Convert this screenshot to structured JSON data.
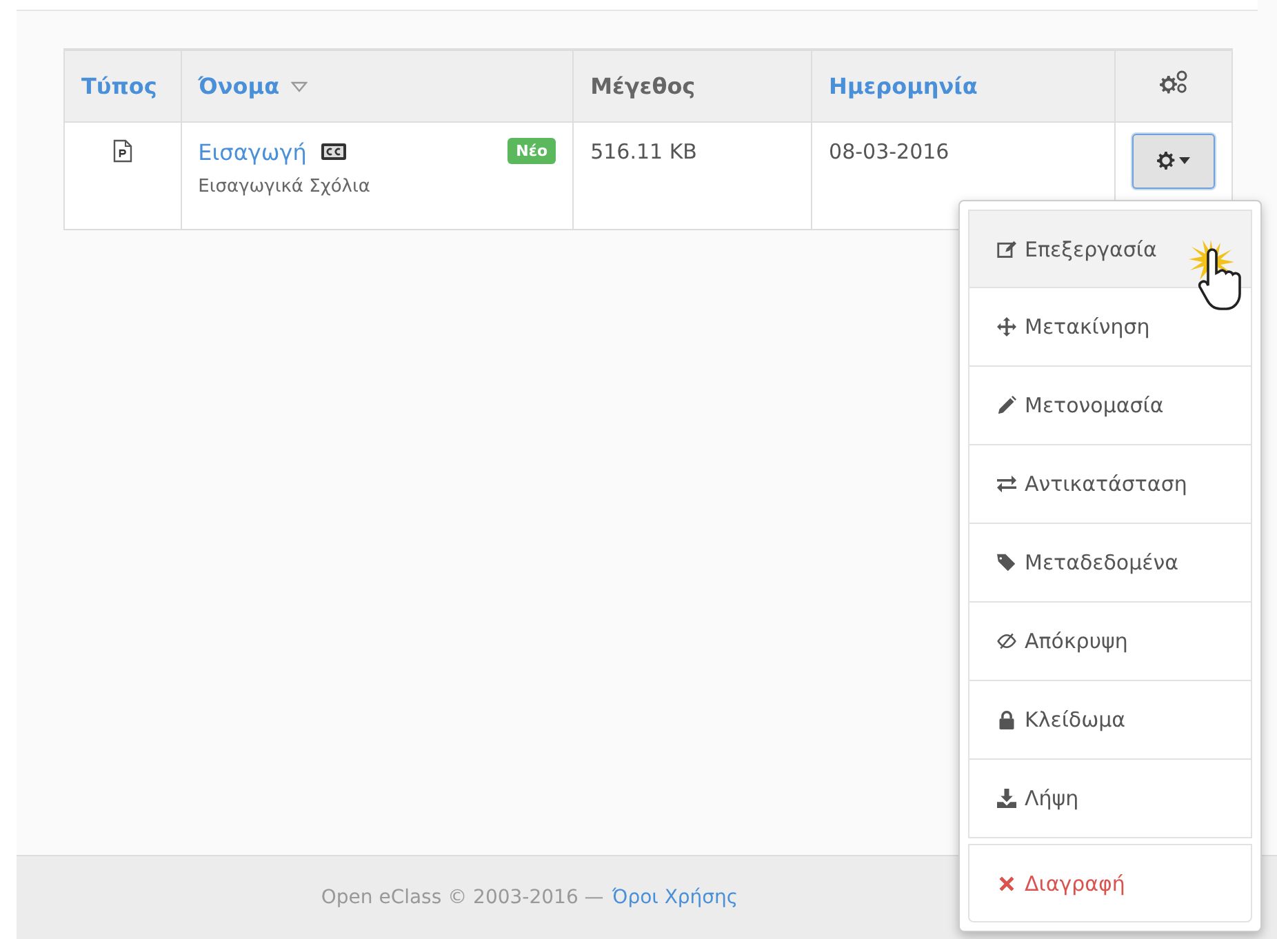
{
  "table": {
    "columns": [
      {
        "label": "Τύπος",
        "link": true,
        "sorted": false
      },
      {
        "label": "Όνομα",
        "link": true,
        "sorted": true
      },
      {
        "label": "Μέγεθος",
        "link": false,
        "sorted": false
      },
      {
        "label": "Ημερομηνία",
        "link": true,
        "sorted": false
      }
    ],
    "rows": [
      {
        "name": "Εισαγωγή",
        "description": "Εισαγωγικά Σχόλια",
        "badge": "Νέο",
        "size": "516.11 KB",
        "date": "08-03-2016",
        "menu_open": true
      }
    ]
  },
  "menu": {
    "items": [
      {
        "label": "Επεξεργασία",
        "kind": "normal",
        "selected": true
      },
      {
        "label": "Μετακίνηση",
        "kind": "normal",
        "selected": false
      },
      {
        "label": "Μετονομασία",
        "kind": "normal",
        "selected": false
      },
      {
        "label": "Αντικατάσταση",
        "kind": "normal",
        "selected": false
      },
      {
        "label": "Μεταδεδομένα",
        "kind": "normal",
        "selected": false
      },
      {
        "label": "Απόκρυψη",
        "kind": "normal",
        "selected": false
      },
      {
        "label": "Κλείδωμα",
        "kind": "normal",
        "selected": false
      },
      {
        "label": "Λήψη",
        "kind": "normal",
        "selected": false
      },
      {
        "label": "Διαγραφή",
        "kind": "danger",
        "selected": false
      }
    ]
  },
  "footer": {
    "text": "Open eClass © 2003-2016 —",
    "link": "Όροι Χρήσης"
  }
}
